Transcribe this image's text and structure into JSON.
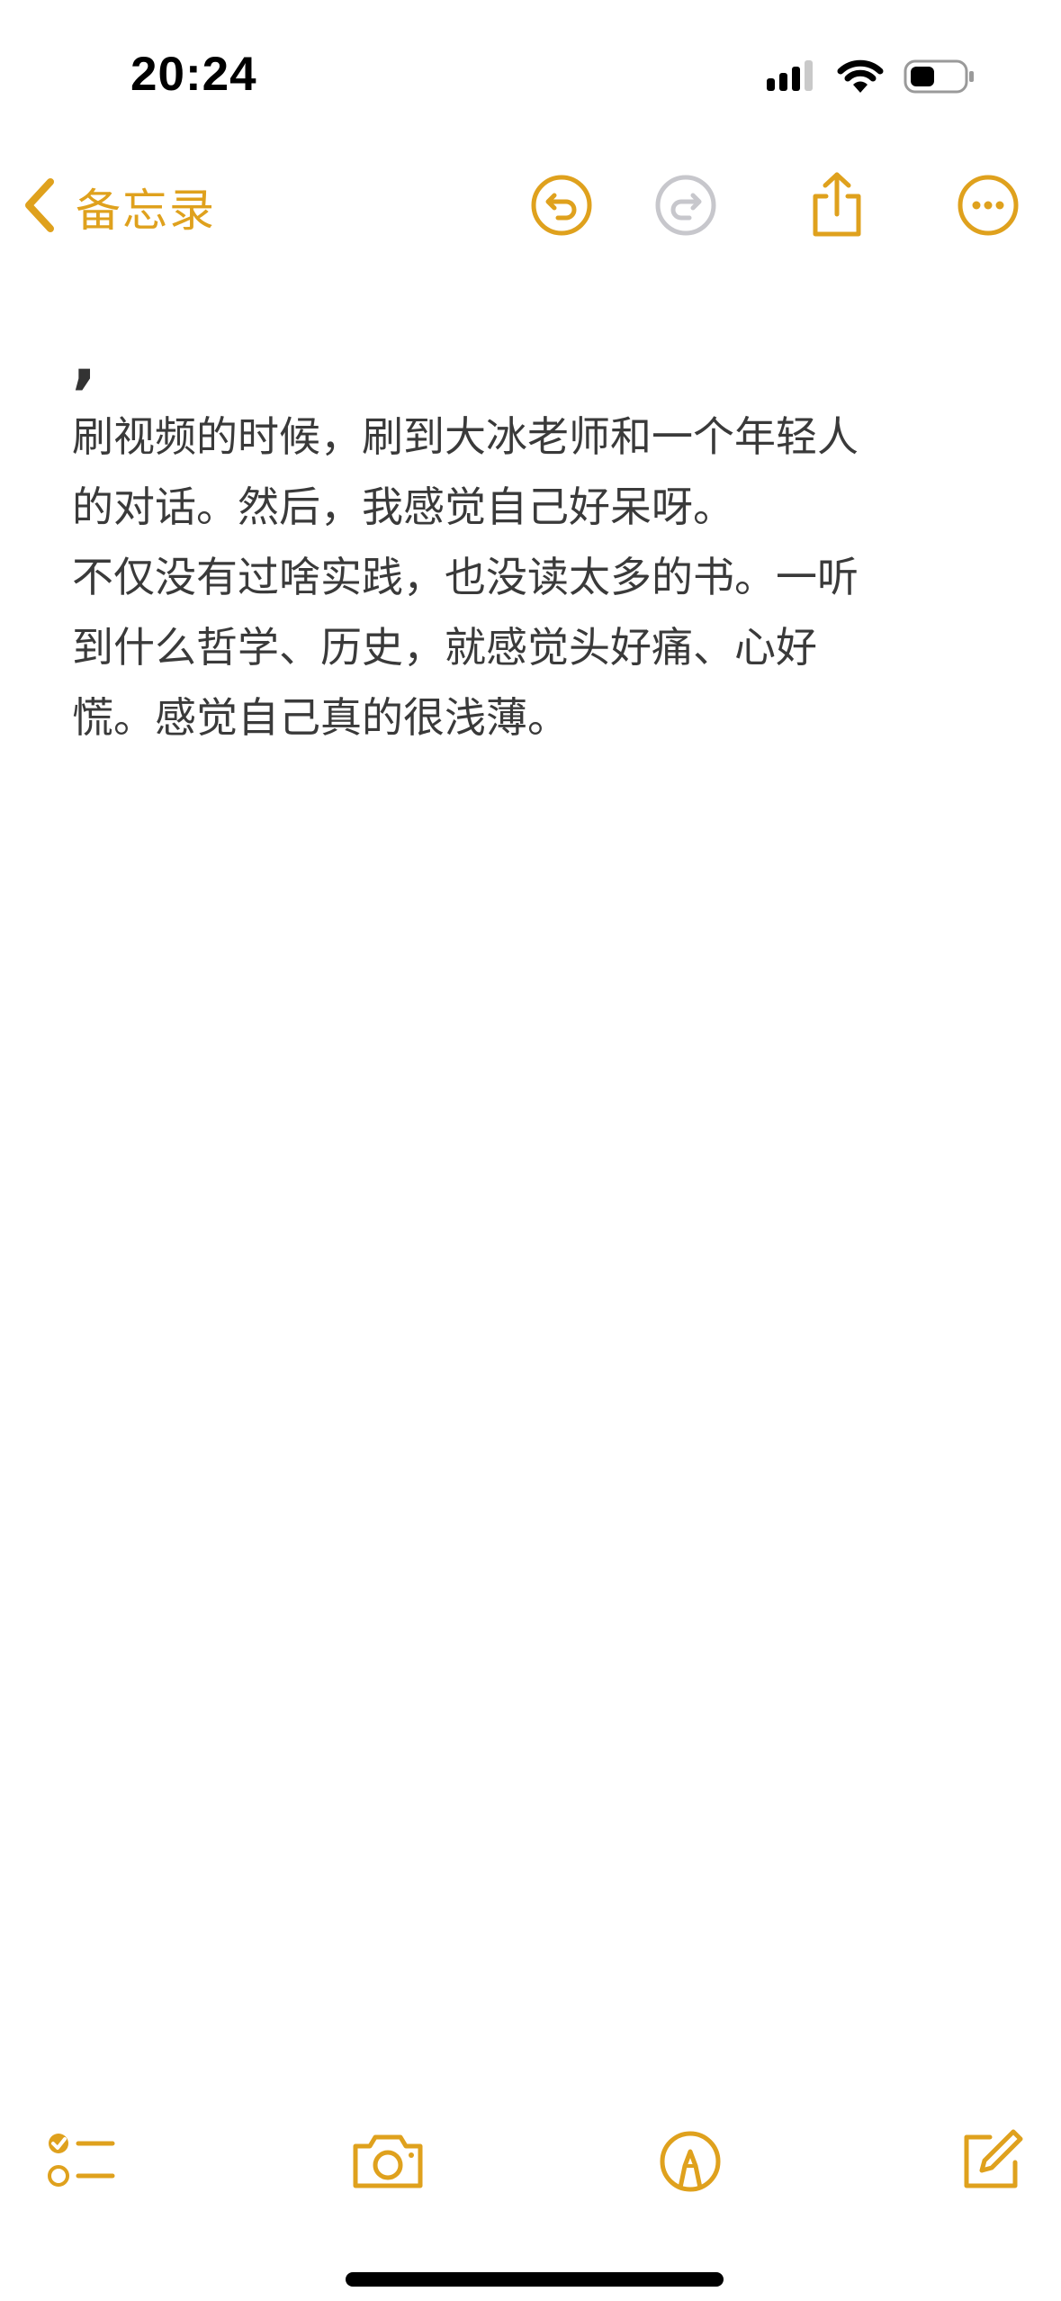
{
  "status_bar": {
    "time": "20:24",
    "icons": [
      "cellular-signal-icon",
      "wifi-icon",
      "battery-icon"
    ]
  },
  "nav": {
    "back_label": "备忘录",
    "icons": [
      "chevron-left-icon",
      "undo-icon",
      "redo-icon",
      "share-icon",
      "more-icon"
    ]
  },
  "note": {
    "title": ",",
    "body": "刷视频的时候，刷到大冰老师和一个年轻人\n的对话。然后，我感觉自己好呆呀。\n不仅没有过啥实践，也没读太多的书。一听\n到什么哲学、历史，就感觉头好痛、心好\n慌。感觉自己真的很浅薄。"
  },
  "toolbar": {
    "icons": [
      "checklist-icon",
      "camera-icon",
      "markup-pen-icon",
      "compose-icon"
    ]
  },
  "colors": {
    "accent": "#DFA11D",
    "disabled": "#C7C7CC",
    "text": "#3a3a3a"
  }
}
